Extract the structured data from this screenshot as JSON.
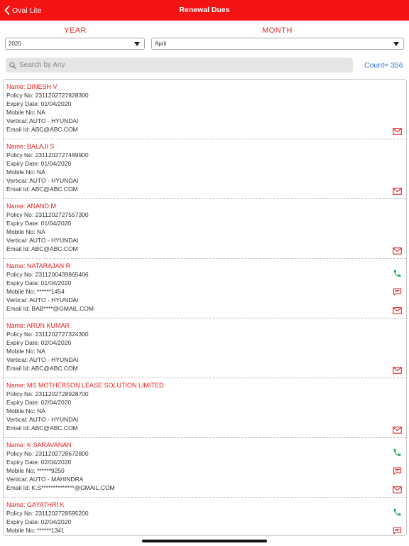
{
  "nav": {
    "back_label": "Oval Lite",
    "title": "Renewal Dues"
  },
  "filters": {
    "year_label": "YEAR",
    "month_label": "MONTH",
    "year_value": "2020",
    "month_value": "April"
  },
  "search": {
    "placeholder": "Search by Any"
  },
  "count": "Count= 356",
  "records": [
    {
      "name": "Name: DINESH V",
      "policy": "Policy No: 2311202727828300",
      "expiry": "Expiry Date: 01/04/2020",
      "mobile": "Mobile No: NA",
      "vertical": "Vertical: AUTO - HYUNDAI",
      "email": "Email Id: ABC@ABC.COM",
      "has_phone": false
    },
    {
      "name": "Name: BALAJI S",
      "policy": "Policy No: 2311202727489900",
      "expiry": "Expiry Date: 01/04/2020",
      "mobile": "Mobile No: NA",
      "vertical": "Vertical: AUTO - HYUNDAI",
      "email": "Email Id: ABC@ABC.COM",
      "has_phone": false
    },
    {
      "name": "Name: ANAND M",
      "policy": "Policy No: 2311202727557300",
      "expiry": "Expiry Date: 01/04/2020",
      "mobile": "Mobile No: NA",
      "vertical": "Vertical: AUTO - HYUNDAI",
      "email": "Email Id: ABC@ABC.COM",
      "has_phone": false
    },
    {
      "name": "Name: NATARAJAN R",
      "policy": "Policy No: 2311200439865406",
      "expiry": "Expiry Date: 01/04/2020",
      "mobile": "Mobile No: ******1454",
      "vertical": "Vertical: AUTO - HYUNDAI",
      "email": "Email Id: BAB****@GMAIL.COM",
      "has_phone": true
    },
    {
      "name": "Name: ARUN KUMAR",
      "policy": "Policy No: 2311202727324300",
      "expiry": "Expiry Date: 02/04/2020",
      "mobile": "Mobile No: NA",
      "vertical": "Vertical: AUTO - HYUNDAI",
      "email": "Email Id: ABC@ABC.COM",
      "has_phone": false
    },
    {
      "name": "Name: MS MOTHERSON LEASE SOLUTION LIMITED",
      "policy": "Policy No: 2311202728928700",
      "expiry": "Expiry Date: 02/04/2020",
      "mobile": "Mobile No: NA",
      "vertical": "Vertical: AUTO - HYUNDAI",
      "email": "Email Id: ABC@ABC.COM",
      "has_phone": false
    },
    {
      "name": "Name: K SARAVANAN",
      "policy": "Policy No: 2311202728672800",
      "expiry": "Expiry Date: 02/04/2020",
      "mobile": "Mobile No: ******9250",
      "vertical": "Vertical: AUTO - MAHINDRA",
      "email": "Email Id: K.S**************@GMAIL.COM",
      "has_phone": true
    },
    {
      "name": "Name: GAYATHRI K",
      "policy": "Policy No: 2311202728595200",
      "expiry": "Expiry Date: 02/04/2020",
      "mobile": "Mobile No: ******1341",
      "vertical": "",
      "email": "",
      "has_phone": true
    }
  ],
  "colors": {
    "nav_red": "#f31313",
    "name_red": "#e32020",
    "count_blue": "#2f6fd1",
    "phone_green": "#1faa59"
  }
}
